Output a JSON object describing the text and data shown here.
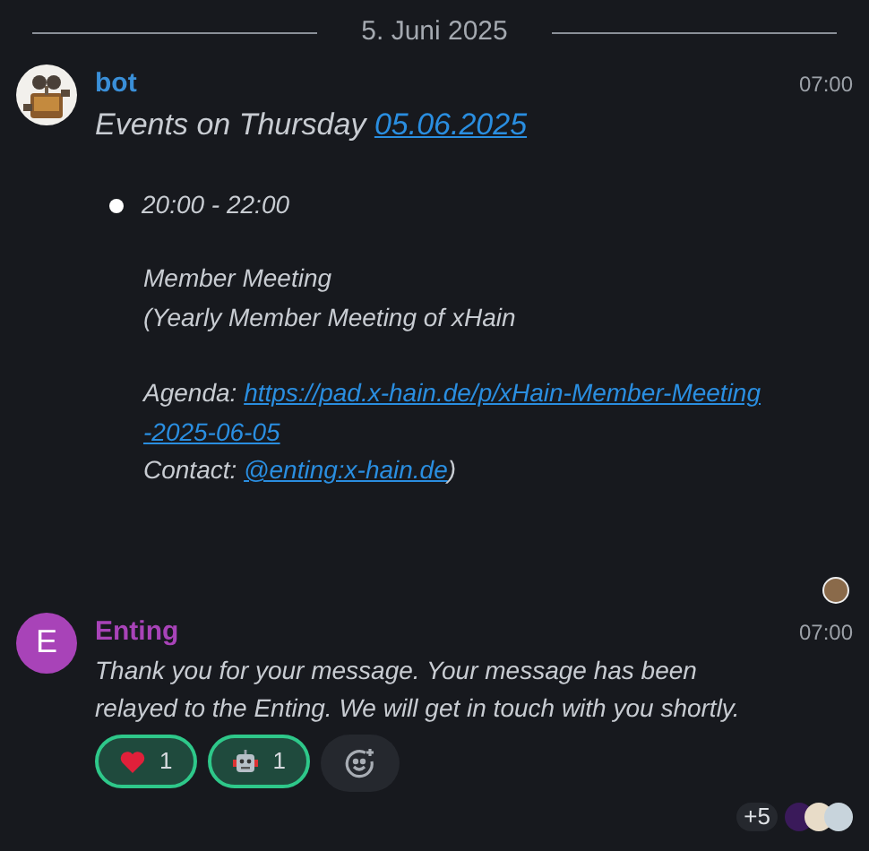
{
  "date_separator": "5. Juni 2025",
  "messages": [
    {
      "kind": "event",
      "sender": "bot",
      "color": "#3a8fd8",
      "time": "07:00",
      "title": "Events on Thursday",
      "title_link": "05.06.2025",
      "event_time": "20:00 - 22:00",
      "lines": [
        "Member Meeting",
        "(Yearly Member Meeting of xHain"
      ],
      "agenda_label": "Agenda:",
      "agenda_link_lines": [
        "https://pad.x-hain.de/p/xHain-Member-Meeting",
        "-2025-06-05"
      ],
      "contact_label": "Contact:",
      "contact_link": "@enting:x-hain.de",
      "contact_suffix": ")"
    },
    {
      "kind": "text",
      "sender": "Enting",
      "avatar_letter": "E",
      "color": "#a843b8",
      "time": "07:00",
      "text": "Thank you for your message. Your message has been relayed to the Enting. We will get in touch with you shortly.",
      "reactions": [
        {
          "kind": "heart",
          "count": "1",
          "selected": true
        },
        {
          "kind": "robot",
          "count": "1",
          "selected": true
        }
      ],
      "more_readers": "+5"
    }
  ]
}
